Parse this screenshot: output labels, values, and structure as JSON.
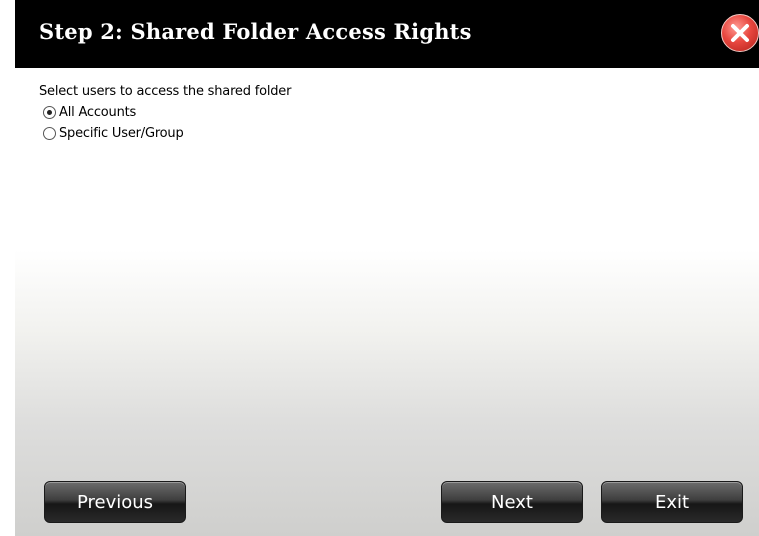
{
  "dialog": {
    "title": "Step 2: Shared Folder Access Rights",
    "close_icon": "close-icon"
  },
  "content": {
    "prompt": "Select users to access the shared folder",
    "options": [
      {
        "label": "All Accounts",
        "selected": true
      },
      {
        "label": "Specific User/Group",
        "selected": false
      }
    ]
  },
  "buttons": {
    "previous": "Previous",
    "next": "Next",
    "exit": "Exit"
  },
  "colors": {
    "title_bar": "#000000",
    "close_button": "#e8473f"
  }
}
